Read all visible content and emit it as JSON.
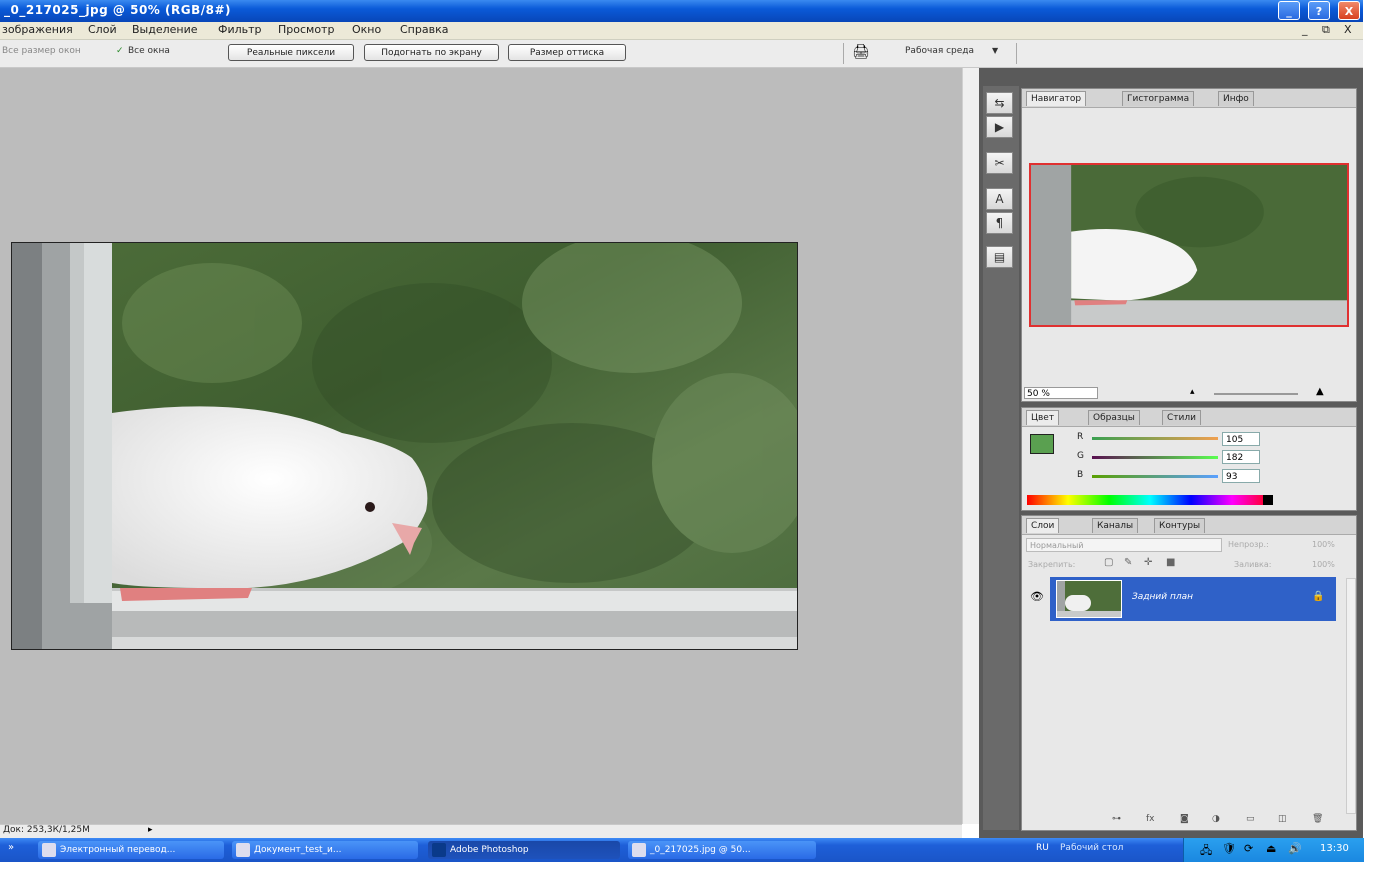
{
  "window": {
    "title": "_0_217025_jpg @ 50% (RGB/8#)",
    "controls": [
      "_",
      "?",
      "X"
    ]
  },
  "menu": {
    "items": [
      "зображения",
      "Слой",
      "Выделение",
      "Фильтр",
      "Просмотр",
      "Окно",
      "Справка"
    ],
    "doc_controls": [
      "_",
      "⧉",
      "X"
    ]
  },
  "options": {
    "label_left": "Все размер окон",
    "check_label": "Все окна",
    "btn_actual": "Реальные пиксели",
    "btn_fit": "Подогнать по экрану",
    "btn_print": "Размер оттиска",
    "workspace": "Рабочая среда"
  },
  "status": {
    "text": "Док: 253,3К/1,25M",
    "nav_arrow": "▸"
  },
  "navigator": {
    "tabs": [
      "Навигатор",
      "Гистограмма",
      "Инфо"
    ],
    "zoom": "50 %"
  },
  "color_panel": {
    "tabs": [
      "Цвет",
      "Образцы",
      "Стили"
    ],
    "labels": [
      "R",
      "G",
      "B"
    ],
    "values": [
      "105",
      "182",
      "93"
    ],
    "swatch_color": "#5aa050"
  },
  "layers_panel": {
    "tabs": [
      "Слои",
      "Каналы",
      "Контуры"
    ],
    "blend_mode": "Нормальный",
    "opacity_label": "Непрозр.:",
    "opacity_value": "100%",
    "lock_label": "Закрепить:",
    "fill_label": "Заливка:",
    "fill_value": "100%",
    "layer_name": "Задний план",
    "layer_selected_color": "#2f61c8"
  },
  "taskbar": {
    "start": "»",
    "tasks": [
      "Электронный перевод...",
      "Документ_test_и...",
      "Adobe Photoshop",
      "_0_217025.jpg @ 50..."
    ],
    "lang": "RU",
    "tray_extra": "Рабочий стол",
    "clock": "13:30"
  },
  "colors": {
    "titlebar": "#0a5ad8",
    "canvas_bg": "#bcbcbc",
    "panel_bg": "#e8e8e8"
  }
}
